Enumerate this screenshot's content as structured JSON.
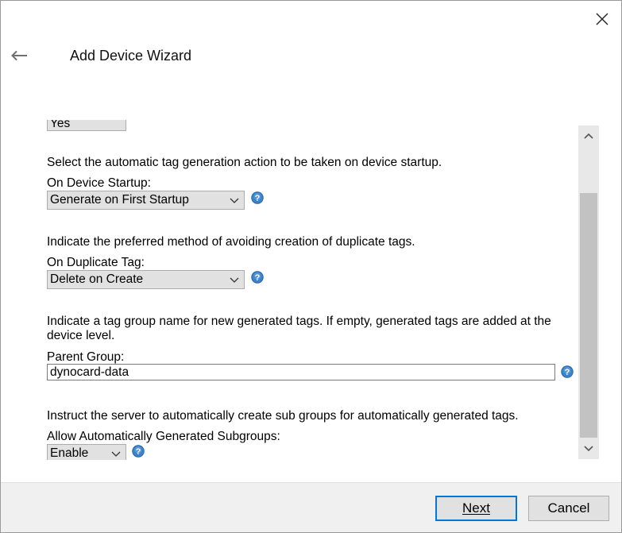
{
  "window": {
    "title": "Add Device Wizard"
  },
  "icons": {
    "close": "close-icon",
    "back": "back-arrow-icon",
    "help": "help-icon",
    "chevron": "chevron-down-icon"
  },
  "colors": {
    "accent": "#0078d7",
    "help_icon": "#3a82c9"
  },
  "sections": {
    "prev_partial": {
      "value": "Yes"
    },
    "startup": {
      "description": "Select the automatic tag generation action to be taken on device startup.",
      "label": "On Device Startup:",
      "value": "Generate on First Startup"
    },
    "duplicate": {
      "description": "Indicate the preferred method of avoiding creation of duplicate tags.",
      "label": "On Duplicate Tag:",
      "value": "Delete on Create"
    },
    "parent_group": {
      "description": "Indicate a tag group name for new generated tags. If empty, generated tags are added at the device level.",
      "label": "Parent Group:",
      "value": "dynocard-data"
    },
    "subgroups": {
      "description": "Instruct the server to automatically create sub groups for automatically generated tags.",
      "label": "Allow Automatically Generated Subgroups:",
      "value": "Enable"
    }
  },
  "buttons": {
    "next": "Next",
    "cancel": "Cancel"
  }
}
